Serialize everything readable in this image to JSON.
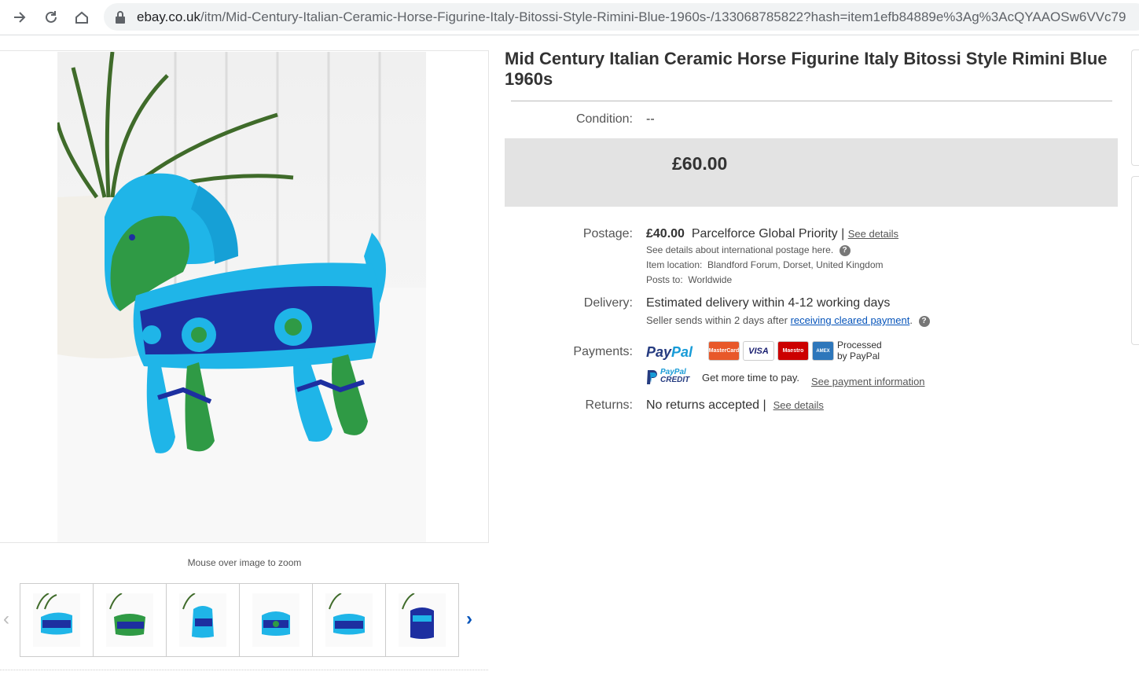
{
  "browser": {
    "url_domain": "ebay.co.uk",
    "url_path": "/itm/Mid-Century-Italian-Ceramic-Horse-Figurine-Italy-Bitossi-Style-Rimini-Blue-1960s-/133068785822?hash=item1efb84889e%3Ag%3AcQYAAOSw6VVc79"
  },
  "gallery": {
    "zoom_hint": "Mouse over image to zoom",
    "thumbnail_count": 6
  },
  "listing": {
    "title": "Mid Century Italian Ceramic Horse Figurine Italy Bitossi Style Rimini Blue 1960s",
    "condition_label": "Condition:",
    "condition_value": "--",
    "price": "£60.00",
    "postage": {
      "label": "Postage:",
      "cost": "£40.00",
      "service": "Parcelforce Global Priority |",
      "see_details": "See details",
      "intl_note": "See details about international postage here.",
      "location_label": "Item location:",
      "location_value": "Blandford Forum, Dorset, United Kingdom",
      "posts_to_label": "Posts to:",
      "posts_to_value": "Worldwide"
    },
    "delivery": {
      "label": "Delivery:",
      "estimate": "Estimated delivery within 4-12 working days",
      "seller_sends": "Seller sends within 2 days after",
      "cleared_payment": "receiving cleared payment",
      "period": "."
    },
    "payments": {
      "label": "Payments:",
      "paypal_pay": "Pay",
      "paypal_pal": "Pal",
      "cards": [
        "MasterCard",
        "VISA",
        "Maestro",
        "AMEX"
      ],
      "processed_line1": "Processed",
      "processed_line2": "by PayPal",
      "credit_line1": "PayPal",
      "credit_line2": "CREDIT",
      "credit_text": "Get more time to pay.",
      "see_payment_info": "See payment information"
    },
    "returns": {
      "label": "Returns:",
      "value": "No returns accepted |",
      "see_details": "See details"
    }
  },
  "colors": {
    "link_blue": "#0654ba",
    "price_box": "#e3e3e3",
    "horse_cyan": "#1fb5e8",
    "horse_green": "#2f9a45",
    "horse_navy": "#1d2fa0"
  }
}
